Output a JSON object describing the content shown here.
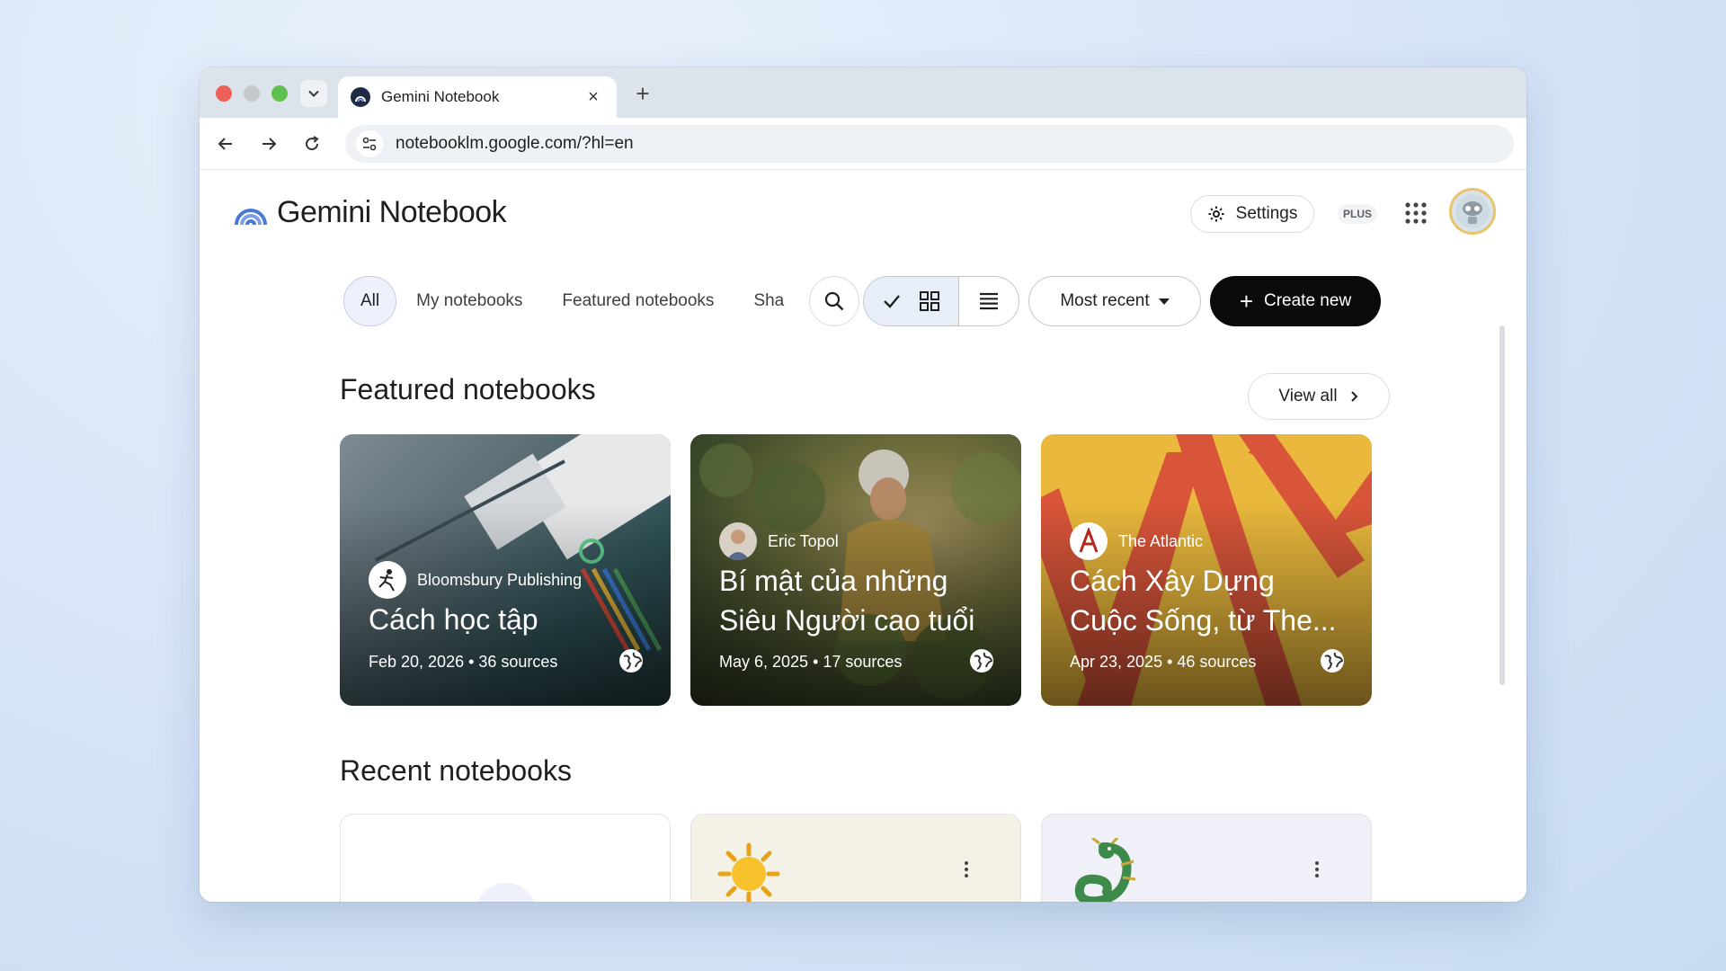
{
  "browser": {
    "tab_title": "Gemini Notebook",
    "tab_close": "×",
    "new_tab": "+",
    "url": "notebooklm.google.com/?hl=en"
  },
  "header": {
    "logo_text": "Gemini Notebook",
    "settings_label": "Settings",
    "plan_badge": "PLUS"
  },
  "filters": {
    "chips": [
      "All",
      "My notebooks",
      "Featured notebooks",
      "Sha"
    ]
  },
  "toolbar": {
    "sort_label": "Most recent",
    "create_label": "Create new"
  },
  "featured": {
    "title": "Featured notebooks",
    "view_all": "View all",
    "cards": [
      {
        "publisher": "Bloomsbury Publishing",
        "title": "Cách học tập",
        "meta": "Feb 20, 2026 • 36 sources"
      },
      {
        "publisher": "Eric Topol",
        "title_line1": "Bí mật của những",
        "title_line2": "Siêu Người cao tuổi",
        "meta": "May 6, 2025 • 17 sources"
      },
      {
        "publisher": "The Atlantic",
        "title_line1": "Cách Xây Dựng",
        "title_line2": "Cuộc Sống, từ The...",
        "meta": "Apr 23, 2025 • 46 sources"
      }
    ]
  },
  "recent": {
    "title": "Recent notebooks"
  },
  "colors": {
    "accent": "#0b0b0b",
    "chip_active_bg": "#eef0fb",
    "logo_blue": "#4a78d6"
  }
}
